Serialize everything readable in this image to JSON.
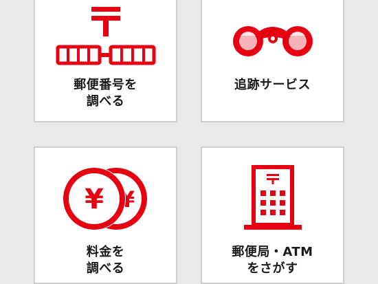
{
  "accent_color": "#e60012",
  "tiles": [
    {
      "icon": "postal-code-icon",
      "label_line1": "郵便番号を",
      "label_line2": "調べる"
    },
    {
      "icon": "binoculars-icon",
      "label_line1": "追跡サービス",
      "label_line2": ""
    },
    {
      "icon": "yen-coins-icon",
      "label_line1": "料金を",
      "label_line2": "調べる"
    },
    {
      "icon": "post-office-building-icon",
      "label_line1": "郵便局・ATM",
      "label_line2": "をさがす"
    }
  ]
}
